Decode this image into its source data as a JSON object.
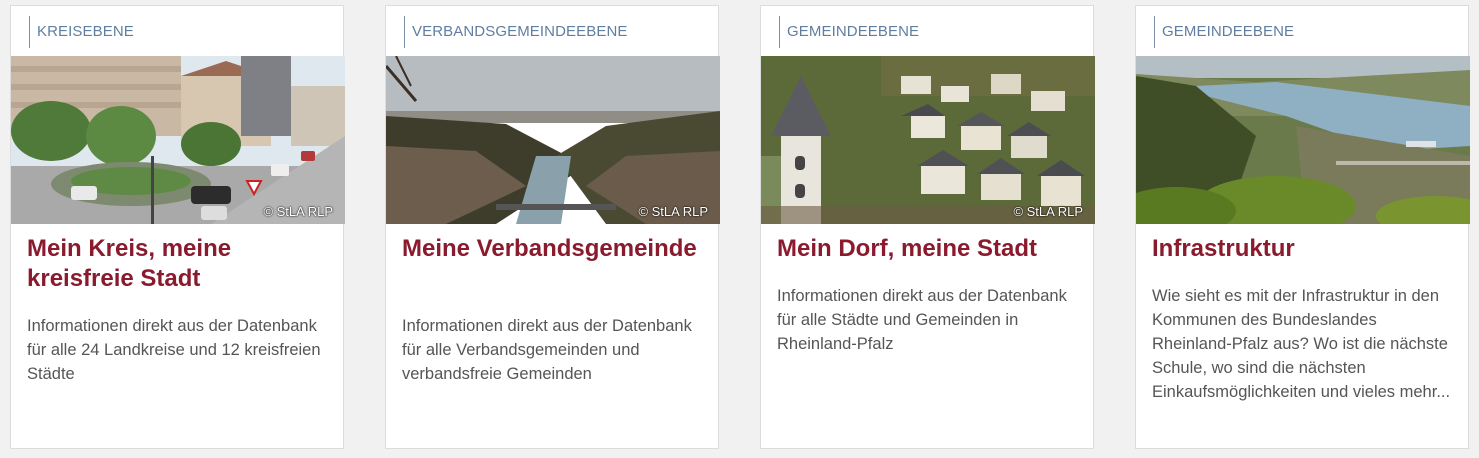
{
  "cards": [
    {
      "level": "KREISEBENE",
      "image_alt": "Kreisverkehr mit Autos und Gebäuden",
      "credit": "© StLA RLP",
      "title": "Mein Kreis, meine kreisfreie Stadt",
      "text": "Informationen direkt aus der Datenbank für alle 24 Landkreise und 12 kreisfreien Städte"
    },
    {
      "level": "VERBANDSGEMEINDEEBENE",
      "image_alt": "Stadt im Flusstal mit Weinbergen",
      "credit": "© StLA RLP",
      "title": "Meine Verbandsgemeinde",
      "text": "Informationen direkt aus der Datenbank für alle Verbandsgemeinden und verbandsfreie Gemeinden"
    },
    {
      "level": "GEMEINDEEBENE",
      "image_alt": "Dorf mit Kirchturm",
      "credit": "© StLA RLP",
      "title": "Mein Dorf, meine Stadt",
      "text": "Informationen direkt aus der Datenbank für alle Städte und Gemeinden in Rheinland-Pfalz"
    },
    {
      "level": "GEMEINDEEBENE",
      "image_alt": "Rheintal mit Fluss und Weinreben",
      "credit": "",
      "title": "Infrastruktur",
      "text": "Wie sieht es mit der Infrastruktur in den Kommunen des Bundeslandes Rheinland-Pfalz aus? Wo ist die nächste Schule, wo sind die nächsten Einkaufsmöglichkeiten und vieles mehr..."
    }
  ],
  "colors": {
    "title": "#8a1a2e",
    "level": "#5f7ea0",
    "text": "#555555",
    "background": "#f1f1f1"
  }
}
